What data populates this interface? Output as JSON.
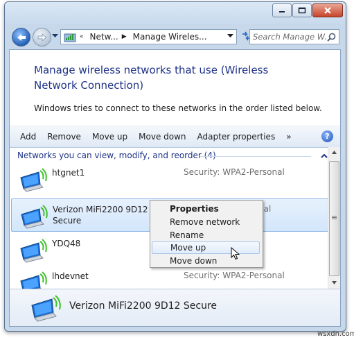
{
  "window": {
    "caption_buttons": [
      {
        "name": "minimize-button",
        "icon": "minimize-icon"
      },
      {
        "name": "maximize-button",
        "icon": "maximize-icon"
      },
      {
        "name": "close-button",
        "icon": "close-icon"
      }
    ]
  },
  "address_bar": {
    "crumbs": [
      "Netw...",
      "Manage Wireles..."
    ],
    "search_placeholder": "Search Manage W..."
  },
  "page": {
    "heading": "Manage wireless networks that use (Wireless Network Connection)",
    "description": "Windows tries to connect to these networks in the order listed below."
  },
  "toolbar": {
    "items": [
      "Add",
      "Remove",
      "Move up",
      "Move down",
      "Adapter properties"
    ],
    "more": "»",
    "help": "?"
  },
  "list": {
    "group_header": "Networks you can view, modify, and reorder (4)",
    "networks": [
      {
        "name": "htgnet1",
        "security": "Security:  WPA2-Personal"
      },
      {
        "name": "Verizon MiFi2200 9D12 Secure",
        "security": "nal"
      },
      {
        "name": "YDQ48",
        "security": ""
      },
      {
        "name": "lhdevnet",
        "security": "Security:  WPA2-Personal"
      }
    ]
  },
  "context_menu": {
    "items": [
      "Properties",
      "Remove network",
      "Rename",
      "Move up",
      "Move down"
    ],
    "default_item": "Properties",
    "hovered_item": "Move up"
  },
  "details": {
    "name": "Verizon MiFi2200 9D12 Secure"
  },
  "watermark": "wsxdn.com",
  "colors": {
    "heading": "#1e3287",
    "selection": "#d3e6fb",
    "window_frame": "#c6d8ea"
  }
}
